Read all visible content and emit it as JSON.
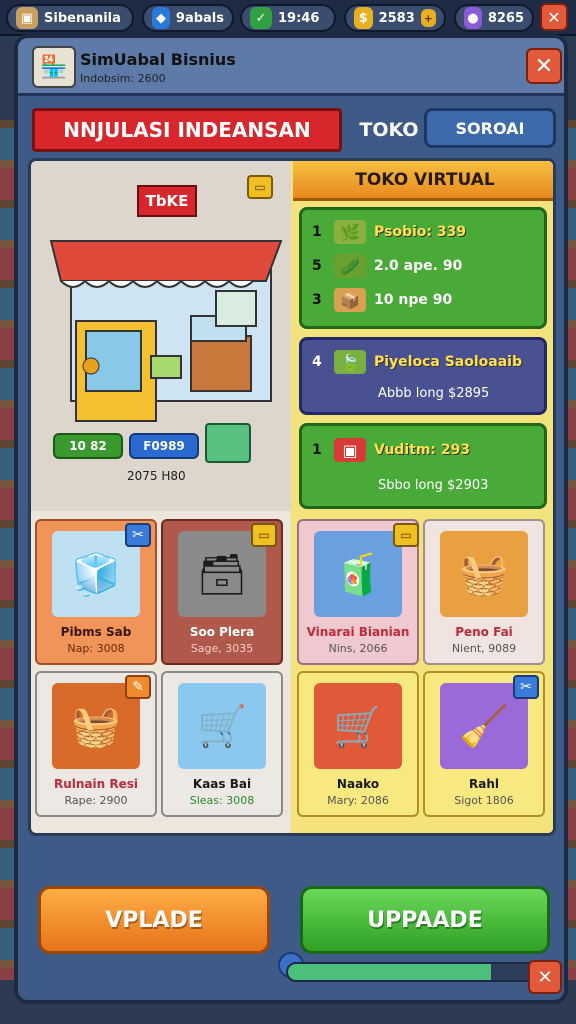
{
  "topbar": {
    "player": "Sibenanila",
    "gems": "9abals",
    "time": "19:46",
    "coins": "2583",
    "stars": "8265"
  },
  "header": {
    "title": "SimUabal Bisnius",
    "subtitle": "Indobsim: 2600"
  },
  "tabs": {
    "main": "NNJULASI INDEANSAN",
    "shop": "TOKO",
    "other": "SOROAI"
  },
  "store": {
    "sign": "TbKE",
    "btn1": "10 82",
    "btn2": "F0989",
    "caption": "2075 H80"
  },
  "virtual": {
    "title": "TOKO VIRTUAL",
    "card1": {
      "rows": [
        {
          "num": "1",
          "label": "Psobio: 339"
        },
        {
          "num": "5",
          "label": "2.0 ape. 90"
        },
        {
          "num": "3",
          "label": "10 npe 90"
        }
      ]
    },
    "card2": {
      "num": "4",
      "title": "Piyeloca Saoloaaib",
      "sub": "Abbb long $2895"
    },
    "card3": {
      "num": "1",
      "title": "Vuditm: 293",
      "sub": "Sbbo long $2903"
    }
  },
  "items": [
    {
      "name": "Pibms Sab",
      "sub": "Nap: 3008"
    },
    {
      "name": "Soo Plera",
      "sub": "Sage, 3035"
    },
    {
      "name": "Vinarai Bianian",
      "sub": "Nins, 2066"
    },
    {
      "name": "Peno Fai",
      "sub": "Nient, 9089"
    },
    {
      "name": "Rulnain Resi",
      "sub": "Rape: 2900"
    },
    {
      "name": "Kaas Bai",
      "sub": "Sleas: 3008"
    },
    {
      "name": "Naako",
      "sub": "Mary: 2086"
    },
    {
      "name": "Rahl",
      "sub": "Sigot 1806"
    }
  ],
  "buttons": {
    "left": "VPLADE",
    "right": "UPPAADE"
  },
  "progress": 0.82,
  "colors": {
    "accent_red": "#d8272c",
    "accent_green": "#4aaa38",
    "accent_orange": "#e8731a"
  }
}
